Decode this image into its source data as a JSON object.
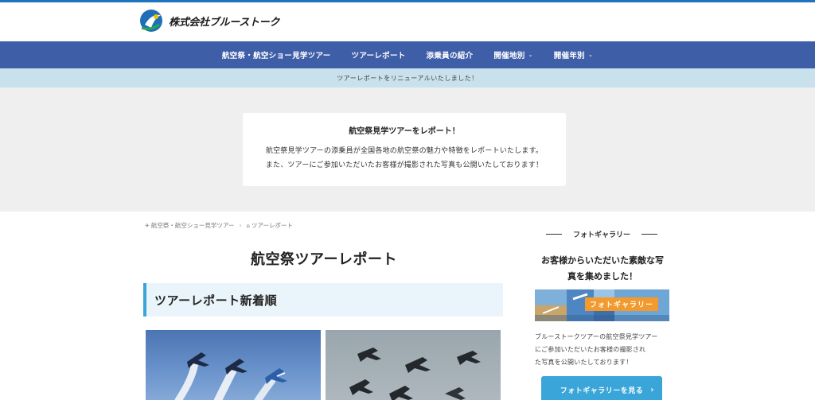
{
  "header": {
    "logo_text": "株式会社ブルーストーク",
    "icons": {
      "logo": "bluestalk-logo-icon"
    }
  },
  "nav": {
    "items": [
      {
        "label": "航空祭・航空ショー見学ツアー",
        "dropdown": false
      },
      {
        "label": "ツアーレポート",
        "dropdown": false
      },
      {
        "label": "添乗員の紹介",
        "dropdown": false
      },
      {
        "label": "開催地別",
        "dropdown": true
      },
      {
        "label": "開催年別",
        "dropdown": true
      }
    ],
    "caret": "⌄"
  },
  "notice": {
    "text": "ツアーレポートをリニューアルいたしました！"
  },
  "hero": {
    "title": "航空祭見学ツアーをレポート！",
    "line1": "航空祭見学ツアーの添乗員が全国各地の航空祭の魅力や特徴をレポートいたします。",
    "line2": "また、ツアーにご参加いただいたお客様が撮影された写真も公開いたしております！"
  },
  "breadcrumb": {
    "items": [
      {
        "label": "航空祭・航空ショー見学ツアー",
        "icon": "plane-icon",
        "glyph": "✈"
      },
      {
        "label": "ツアーレポート",
        "icon": "home-icon",
        "glyph": "⌂"
      }
    ],
    "separator": "›"
  },
  "main": {
    "page_title": "航空祭ツアーレポート",
    "section_title": "ツアーレポート新着順",
    "thumbnails": [
      {
        "icon": "blue-impulse-photo"
      },
      {
        "icon": "f4-phantom-photo"
      }
    ]
  },
  "sidebar": {
    "title": "フォトギャラリー",
    "catch_line1": "お客様からいただいた素敵な写",
    "catch_line2": "真を集めました！",
    "banner_label": "フォトギャラリー",
    "desc_line1": "ブルーストークツアーの航空祭見学ツアー",
    "desc_line2": "にご参加いただいたお客様の撮影され",
    "desc_line3": "た写真を公開いたしております！",
    "button_label": "フォトギャラリーを見る",
    "button_arrow": "›"
  },
  "colors": {
    "topbar": "#1e73be",
    "nav": "#3f5ea8",
    "notice": "#c8e1ec",
    "hero_bg": "#efefef",
    "accent": "#3aa5d8",
    "banner_label": "#f29a2e"
  }
}
